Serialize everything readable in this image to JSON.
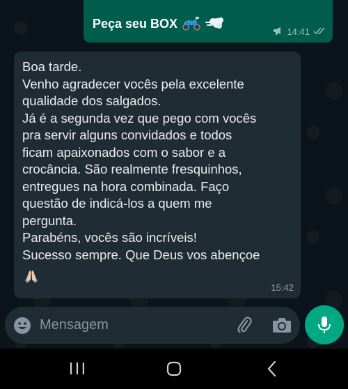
{
  "outgoing_message": {
    "text": "Peça seu BOX",
    "emojis": [
      "scooter-icon",
      "dash-icon"
    ],
    "time": "14:41",
    "status": "read"
  },
  "incoming_message": {
    "lines": [
      "Boa tarde.",
      "Venho agradecer vocês pela excelente",
      "qualidade dos salgados.",
      "Já é a segunda vez que pego com vocês",
      "pra servir alguns convidados e todos",
      "ficam apaixonados com o sabor e a",
      "crocância. São realmente fresquinhos,",
      "entregues na hora combinada. Faço",
      "questão de indicá-los a quem me",
      "pergunta.",
      "Parabéns, vocês são incríveis!",
      "Sucesso sempre. Que Deus vos abençoe"
    ],
    "emoji": "folded-hands-icon",
    "time": "15:42"
  },
  "composer": {
    "placeholder": "Mensagem"
  },
  "colors": {
    "chat_background": "#0b141a",
    "outgoing_bubble": "#005c4b",
    "incoming_bubble": "#202c33",
    "accent": "#00a884"
  }
}
